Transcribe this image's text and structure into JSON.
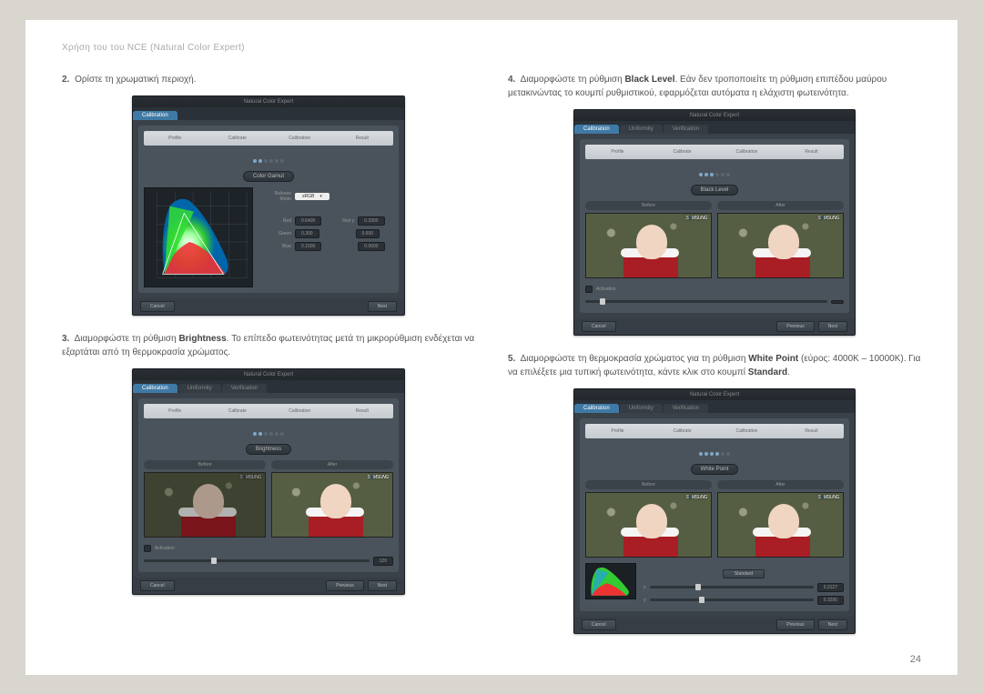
{
  "header": "Χρήση του του NCE (Natural Color Expert)",
  "page_number": "24",
  "app": {
    "title": "Natural Color Expert",
    "tabs": {
      "calibration": "Calibration",
      "uniformity": "Uniformity",
      "verification": "Verification"
    },
    "steps": {
      "profile": "Profile",
      "calibrate": "Calibrate",
      "calibration": "Calibration",
      "result": "Result"
    },
    "before": "Before",
    "after": "After",
    "activation": "Activation",
    "cancel": "Cancel",
    "previous": "Previous",
    "next": "Next",
    "standard": "Standard",
    "logo": "SAMSUNG"
  },
  "step2": {
    "text": "Ορίστε τη χρωματική περιοχή.",
    "pill": "Color Gamut",
    "release_mode": "Release Mode",
    "mode_value": "sRGB",
    "rows": [
      {
        "color": "Red",
        "x": "0.6400",
        "y": "0.3300"
      },
      {
        "color": "Green",
        "x": "0.300",
        "y": "0.600"
      },
      {
        "color": "Blue",
        "x": "0.1500",
        "y": "0.0600"
      }
    ],
    "xlabel": "Red x",
    "ylabel": "Red y"
  },
  "step3": {
    "pre": "Διαμορφώστε τη ρύθμιση ",
    "bold": "Brightness",
    "post": ". Το επίπεδο φωτεινότητας μετά τη μικρορύθμιση ενδέχεται να εξαρτάται από τη θερμοκρασία χρώματος.",
    "pill": "Brightness",
    "value": "120"
  },
  "step4": {
    "pre": "Διαμορφώστε τη ρύθμιση ",
    "bold": "Black Level",
    "post": ". Εάν δεν τροποποιείτε τη ρύθμιση επιπέδου μαύρου μετακινώντας το κουμπί ρυθμιστικού, εφαρμόζεται αυτόματα η ελάχιστη φωτεινότητα.",
    "pill": "Black Level"
  },
  "step5": {
    "pre": "Διαμορφώστε τη θερμοκρασία χρώματος για τη ρύθμιση ",
    "bold": "White Point",
    "mid": " (εύρος: 4000K – 10000K). Για να επιλέξετε μια τυπική φωτεινότητα, κάντε κλικ στο κουμπί ",
    "bold2": "Standard",
    "post": ".",
    "pill": "White Point",
    "x": "0.3127",
    "y": "0.3290"
  }
}
